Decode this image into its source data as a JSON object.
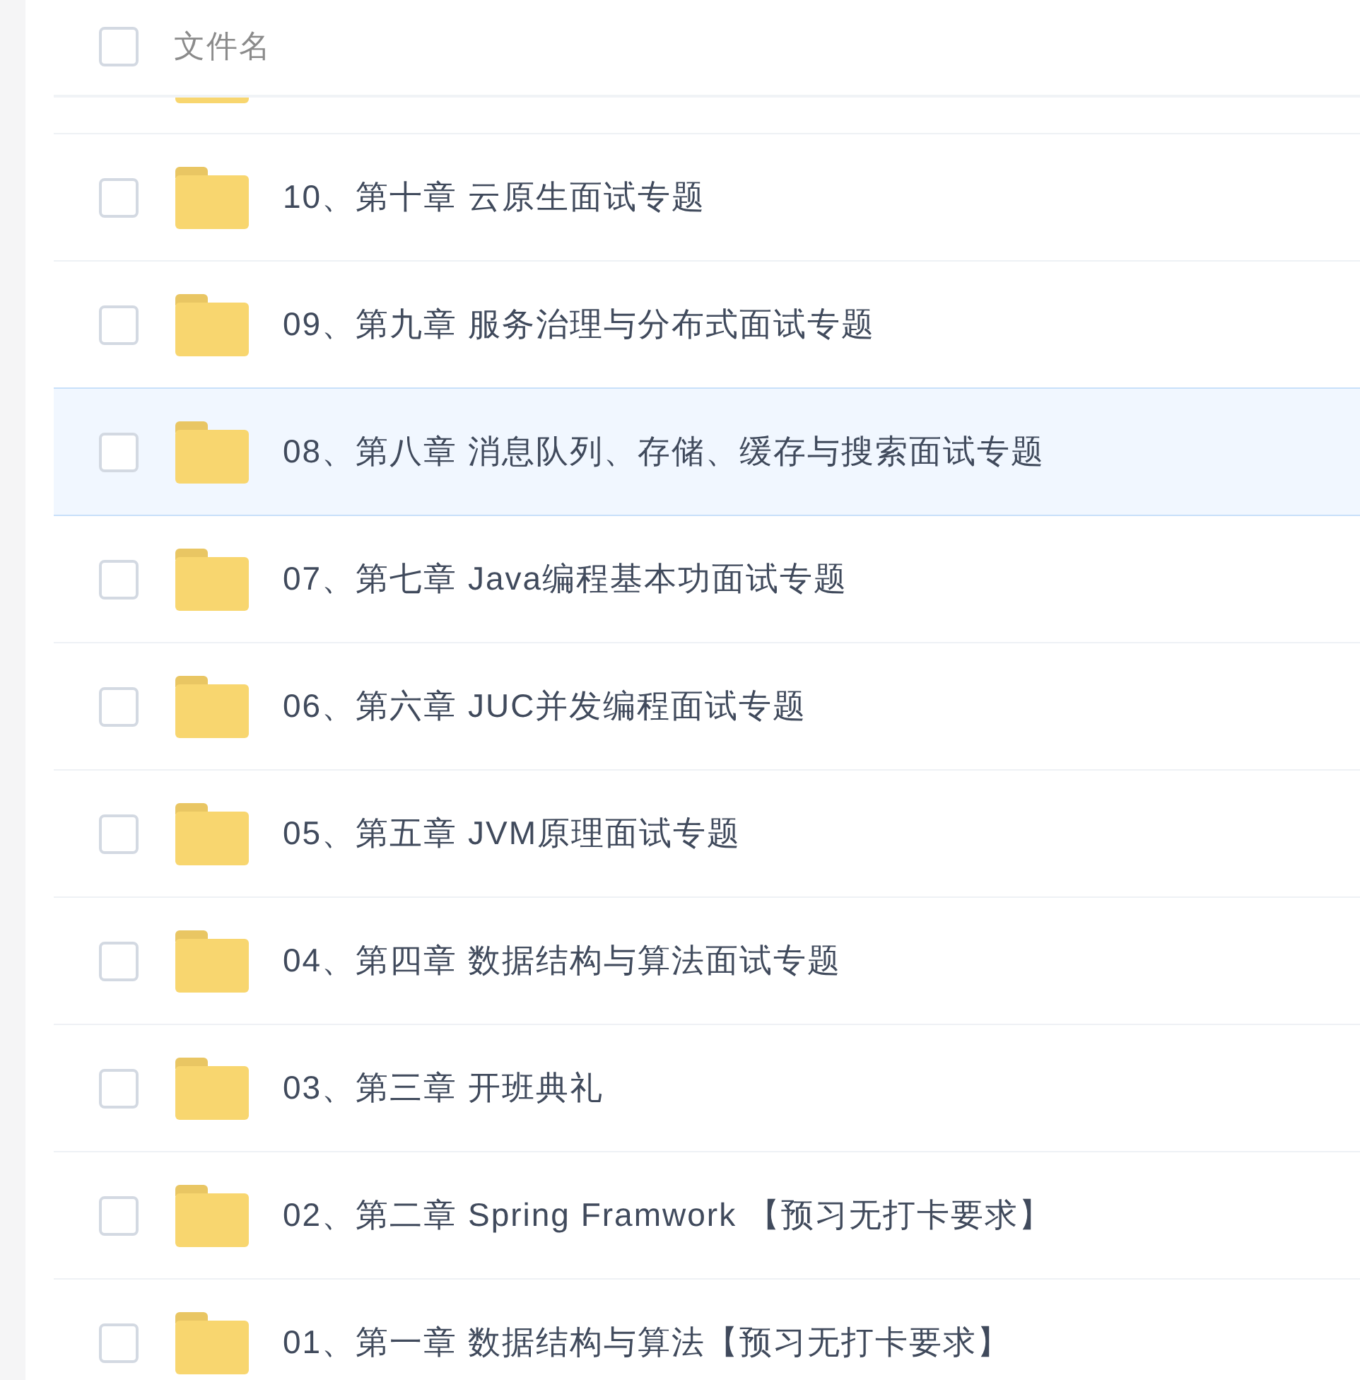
{
  "header": {
    "checkbox": {
      "checked": false
    },
    "column": "文件名"
  },
  "rows": [
    {
      "kind": "folder",
      "name": "10、第十章 云原生面试专题",
      "checked": false,
      "highlighted": false
    },
    {
      "kind": "folder",
      "name": "09、第九章 服务治理与分布式面试专题",
      "checked": false,
      "highlighted": false
    },
    {
      "kind": "folder",
      "name": "08、第八章 消息队列、存储、缓存与搜索面试专题",
      "checked": false,
      "highlighted": true
    },
    {
      "kind": "folder",
      "name": "07、第七章 Java编程基本功面试专题",
      "checked": false,
      "highlighted": false
    },
    {
      "kind": "folder",
      "name": "06、第六章 JUC并发编程面试专题",
      "checked": false,
      "highlighted": false
    },
    {
      "kind": "folder",
      "name": "05、第五章 JVM原理面试专题",
      "checked": false,
      "highlighted": false
    },
    {
      "kind": "folder",
      "name": "04、第四章 数据结构与算法面试专题",
      "checked": false,
      "highlighted": false
    },
    {
      "kind": "folder",
      "name": "03、第三章 开班典礼",
      "checked": false,
      "highlighted": false
    },
    {
      "kind": "folder",
      "name": "02、第二章 Spring Framwork 【预习无打卡要求】",
      "checked": false,
      "highlighted": false
    },
    {
      "kind": "folder",
      "name": "01、第一章 数据结构与算法【预习无打卡要求】",
      "checked": false,
      "highlighted": false
    }
  ]
}
